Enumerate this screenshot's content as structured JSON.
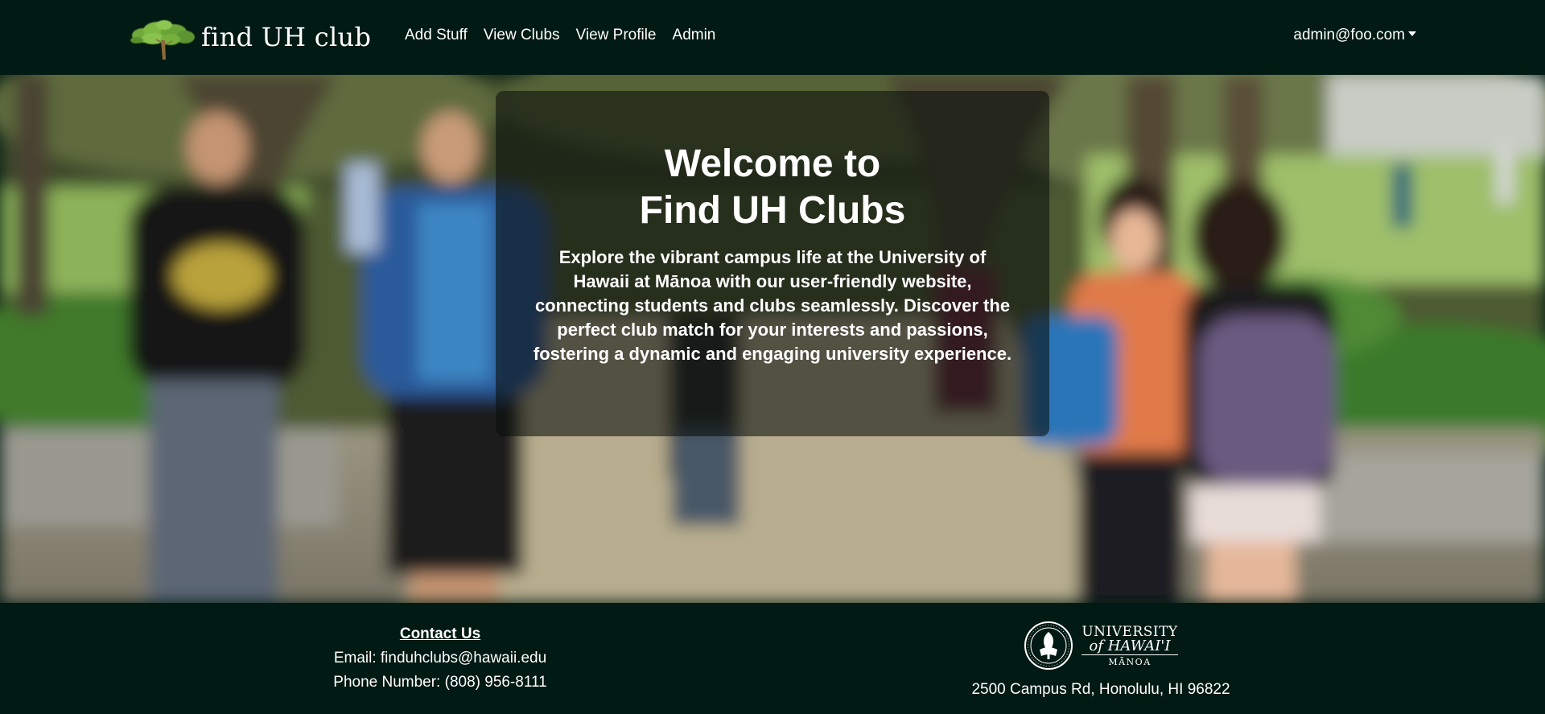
{
  "navbar": {
    "brand": "find UH club",
    "links": [
      "Add Stuff",
      "View Clubs",
      "View Profile",
      "Admin"
    ],
    "user": "admin@foo.com"
  },
  "hero": {
    "title": "Welcome to\nFind UH Clubs",
    "description": "Explore the vibrant campus life at the University of Hawaii at Mānoa with our user-friendly website, connecting students and clubs seamlessly. Discover the perfect club match for your interests and passions, fostering a dynamic and engaging university experience."
  },
  "footer": {
    "contact_heading": "Contact Us",
    "email": "Email: finduhclubs@hawaii.edu",
    "phone": "Phone Number: (808) 956-8111",
    "logo": {
      "line1": "UNIVERSITY",
      "line2": "of HAWAI'I",
      "line3": "MĀNOA"
    },
    "address": "2500 Campus Rd, Honolulu, HI 96822"
  },
  "colors": {
    "navbar_bg": "#011a13",
    "footer_bg": "#011a13",
    "card_bg": "rgba(10,15,12,0.58)",
    "text": "#ffffff"
  },
  "icons": [
    "tree-logo-icon",
    "caret-down-icon",
    "uh-seal-icon"
  ]
}
